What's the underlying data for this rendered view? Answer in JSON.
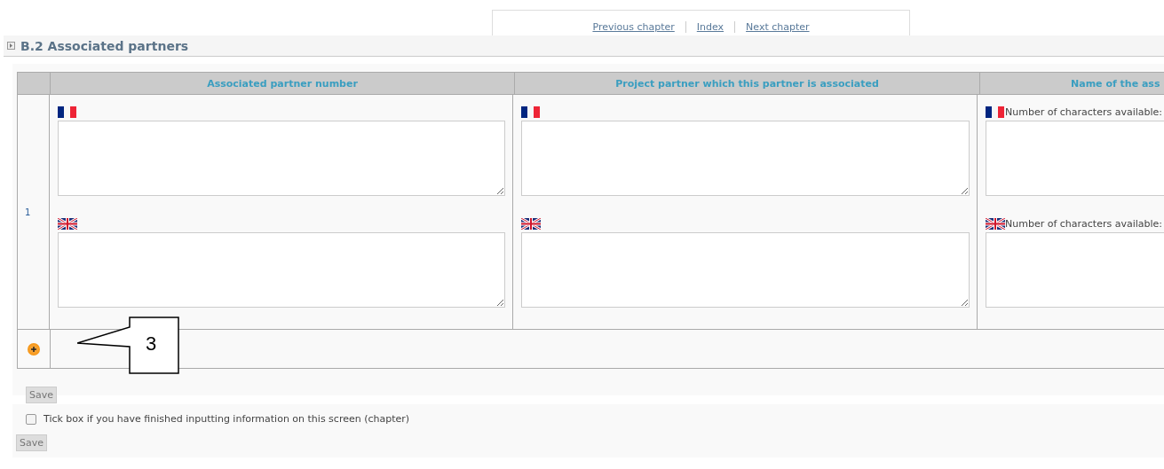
{
  "nav": {
    "links": [
      "Previous chapter",
      "Index",
      "Next chapter"
    ]
  },
  "section": {
    "title": "B.2 Associated partners"
  },
  "table": {
    "columns": [
      "Associated partner number",
      "Project partner which this partner is associated",
      "Name of the ass"
    ],
    "rows": [
      {
        "number": "1",
        "cells": [
          {
            "entries": [
              {
                "kind": "french"
              },
              {
                "kind": "british"
              }
            ]
          },
          {
            "entries": [
              {
                "kind": "french"
              },
              {
                "kind": "british"
              }
            ]
          },
          {
            "entries": [
              {
                "kind": "french",
                "note": "Number of characters available:"
              },
              {
                "kind": "british",
                "note": "Number of characters available:"
              }
            ]
          }
        ]
      }
    ]
  },
  "callout": {
    "label": "3"
  },
  "save_button": "Save",
  "finished": {
    "label": "Tick box if you have finished inputting information on this screen (chapter)",
    "checked": false
  },
  "bottom_save_button": "Save"
}
